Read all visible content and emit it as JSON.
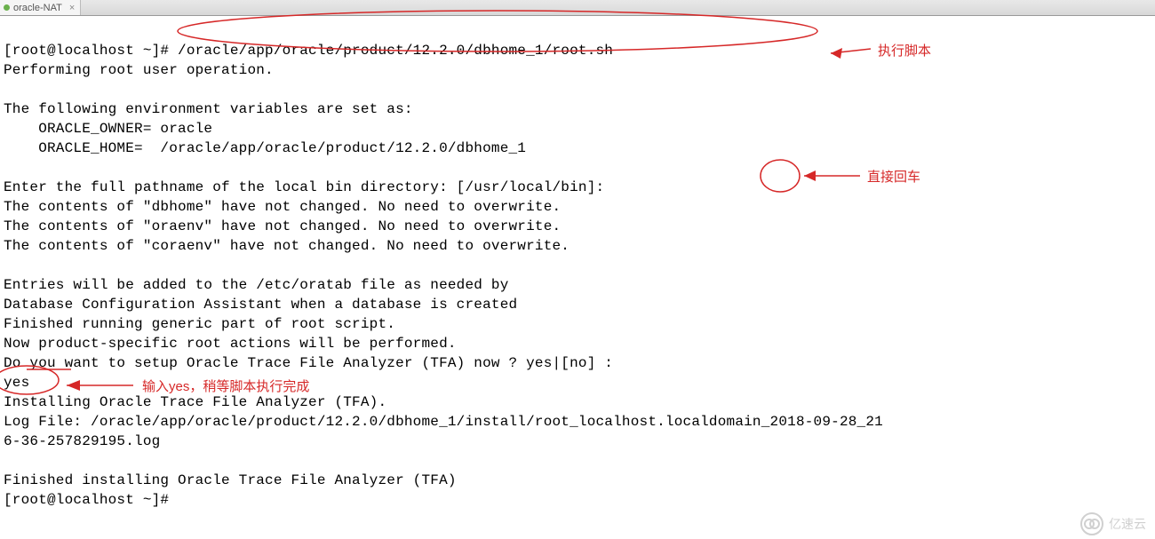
{
  "tab": {
    "title": "oracle-NAT",
    "close": "×"
  },
  "terminal": {
    "lines": [
      "[root@localhost ~]# /oracle/app/oracle/product/12.2.0/dbhome_1/root.sh",
      "Performing root user operation.",
      "",
      "The following environment variables are set as:",
      "    ORACLE_OWNER= oracle",
      "    ORACLE_HOME=  /oracle/app/oracle/product/12.2.0/dbhome_1",
      "",
      "Enter the full pathname of the local bin directory: [/usr/local/bin]:",
      "The contents of \"dbhome\" have not changed. No need to overwrite.",
      "The contents of \"oraenv\" have not changed. No need to overwrite.",
      "The contents of \"coraenv\" have not changed. No need to overwrite.",
      "",
      "Entries will be added to the /etc/oratab file as needed by",
      "Database Configuration Assistant when a database is created",
      "Finished running generic part of root script.",
      "Now product-specific root actions will be performed.",
      "Do you want to setup Oracle Trace File Analyzer (TFA) now ? yes|[no] :",
      "yes",
      "Installing Oracle Trace File Analyzer (TFA).",
      "Log File: /oracle/app/oracle/product/12.2.0/dbhome_1/install/root_localhost.localdomain_2018-09-28_21",
      "6-36-257829195.log",
      "",
      "Finished installing Oracle Trace File Analyzer (TFA)",
      "[root@localhost ~]#"
    ]
  },
  "annotations": {
    "a1": "执行脚本",
    "a2": "直接回车",
    "a3": "输入yes，稍等脚本执行完成"
  },
  "watermark": "亿速云"
}
